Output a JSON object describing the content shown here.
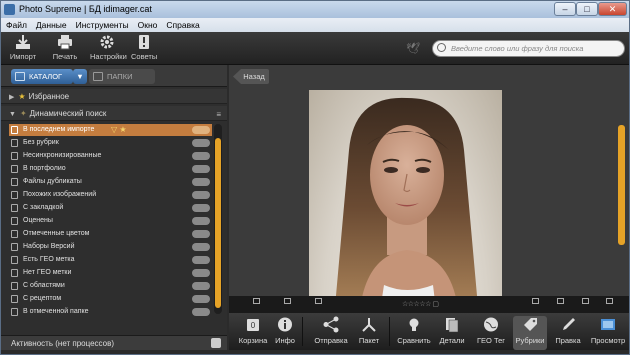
{
  "window": {
    "title": "Photo Supreme | БД idimager.cat"
  },
  "menubar": [
    "Файл",
    "Данные",
    "Инструменты",
    "Окно",
    "Справка"
  ],
  "toolbar": {
    "import": "Импорт",
    "print": "Печать",
    "settings": "Настройки",
    "tips": "Советы",
    "search_placeholder": "Введите слово или фразу для поиска"
  },
  "left": {
    "tab_catalog": "КАТАЛОГ",
    "tab_folders": "ПАПКИ",
    "favorites": "Избранное",
    "dynamic_search": "Динамический поиск",
    "items": [
      "В последнем импорте",
      "Без рубрик",
      "Несинхронизированные",
      "В портфолио",
      "Файлы дубликаты",
      "Похожих изображений",
      "С закладкой",
      "Оценены",
      "Отмеченные цветом",
      "Наборы Версий",
      "Есть ГЕО метка",
      "Нет ГЕО метки",
      "С областями",
      "С рецептом",
      "В отмеченной папке"
    ],
    "status": "Активность (нет процессов)"
  },
  "right": {
    "back": "Назад"
  },
  "bottom": {
    "basket": "Корзина",
    "info": "Инфо",
    "share": "Отправка",
    "batch": "Пакет",
    "compare": "Сравнить",
    "details": "Детали",
    "geotag": "ГЕО Тег",
    "categories": "Рубрики",
    "edit": "Правка",
    "preview": "Просмотр"
  },
  "colors": {
    "accent": "#e6a327",
    "selection": "#c47d3f",
    "catalog_tab": "#3f74b0"
  }
}
